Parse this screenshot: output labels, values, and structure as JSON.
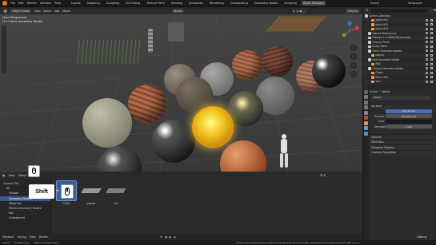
{
  "topbar": {
    "menus": [
      "File",
      "Edit",
      "Render",
      "Window",
      "Help"
    ],
    "workspaces": [
      "Layout",
      "Modeling",
      "Sculpting",
      "UV Editing",
      "Texture Paint",
      "Shading",
      "Animation",
      "Rendering",
      "Compositing",
      "Geometry Nodes",
      "Scripting",
      "Asset Manager"
    ],
    "active_workspace": "Asset Manager",
    "scene_label": "Scene",
    "view_layer_label": "ViewLayer"
  },
  "viewport_header": {
    "mode": "Object Mode",
    "menus": [
      "View",
      "Select",
      "Add",
      "Object"
    ],
    "transform": "Global",
    "options": "Options"
  },
  "viewport": {
    "title_line1": "User Perspective",
    "title_line2": "(1) Chains Geometry Nodes"
  },
  "browser_header": {
    "menus": [
      "View",
      "Select",
      "Asset"
    ],
    "library_label": "Current File"
  },
  "categories": {
    "items": [
      "All",
      "Foliage",
      "Geometry Nodes",
      "Materials",
      "Pieces Geometry Nodes",
      "Rail",
      "Unassigned"
    ],
    "selected": "Geometry Nodes"
  },
  "assets": [
    {
      "name": "Chain"
    },
    {
      "name": "planks"
    },
    {
      "name": "rail"
    }
  ],
  "overlay": {
    "shift_label": "Shift",
    "plus": "+"
  },
  "timeline": {
    "items": [
      "Playback",
      "Keying",
      "View",
      "Marker"
    ]
  },
  "statusbar": {
    "left": "Select",
    "mid": "Rotate View",
    "mid2": "Object Context Menu",
    "right": "Chains Geometry Nodes | Verts:1,172,290 | Faces:2,232,308 | Objects:0/33 | Memory:234.5 MiB | 3.3.1"
  },
  "outliner": {
    "search_placeholder": "",
    "rows": [
      {
        "label": "Scene Collection",
        "color": "#cfcfcf"
      },
      {
        "label": "plank.001",
        "color": "#e8a05a"
      },
      {
        "label": "plank.002",
        "color": "#e8a05a"
      },
      {
        "label": "plank.003",
        "color": "#e8a05a"
      },
      {
        "label": "Sphere References",
        "color": "#cfcfcf"
      },
      {
        "label": "Frames 1-4 (Material-Unsubd)",
        "color": "#cfcfcf"
      },
      {
        "label": "Ground Plane",
        "color": "#cfcfcf"
      },
      {
        "label": "Grass Plane",
        "color": "#cfcfcf"
      },
      {
        "label": "Plank Geometry Nodes",
        "color": "#cfcfcf"
      },
      {
        "label": "planks",
        "color": "#e8a05a"
      },
      {
        "label": "Rail Geometry Nodes",
        "color": "#cfcfcf"
      },
      {
        "label": "Rail",
        "color": "#e8a05a"
      },
      {
        "label": "Chains Geometry Nodes",
        "color": "#cfcfcf"
      },
      {
        "label": "Chain",
        "color": "#e8a05a"
      },
      {
        "label": "Plane.004",
        "color": "#e8a05a"
      },
      {
        "label": "Sun",
        "color": "#e8a05a"
      }
    ]
  },
  "properties": {
    "breadcrumb_scene": "Scene",
    "breadcrumb_world": "World",
    "world_name": "World",
    "surface_header": "Surface",
    "surface_value": "Use Nodes",
    "surface_label": "Surface",
    "surface_shader": "Background",
    "color_label": "Color",
    "strength_label": "Strength",
    "strength_value": "1.000",
    "panels": [
      "Volume",
      "Mist Pass",
      "Viewport Display",
      "Custom Properties"
    ]
  },
  "watermark": "Udemy",
  "colors": {
    "accent_blue": "#3a5a8a",
    "blender_orange": "#e87d0d",
    "selected_asset": "#4772b3"
  }
}
